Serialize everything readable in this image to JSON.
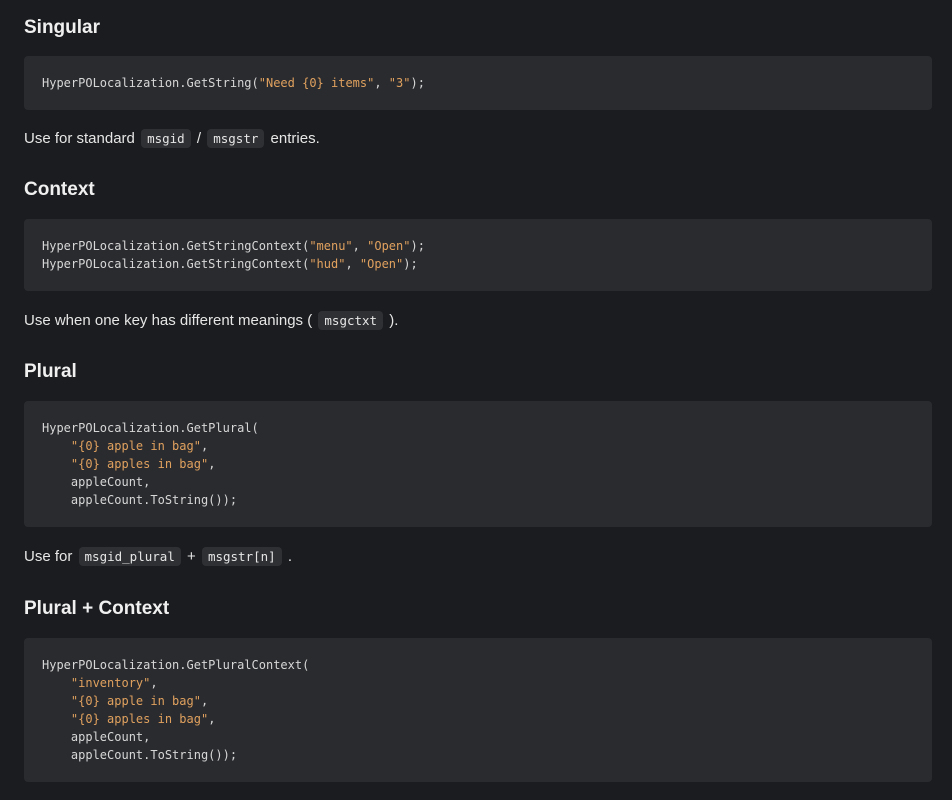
{
  "sections": [
    {
      "heading": "Singular",
      "code_lines": [
        [
          {
            "t": "HyperPOLocalization.GetString(",
            "s": false
          },
          {
            "t": "\"Need {0} items\"",
            "s": true
          },
          {
            "t": ", ",
            "s": false
          },
          {
            "t": "\"3\"",
            "s": true
          },
          {
            "t": ");",
            "s": false
          }
        ]
      ],
      "desc": {
        "before": "Use for standard",
        "code1": "msgid",
        "sep": "/",
        "code2": "msgstr",
        "after": "entries."
      }
    },
    {
      "heading": "Context",
      "code_lines": [
        [
          {
            "t": "HyperPOLocalization.GetStringContext(",
            "s": false
          },
          {
            "t": "\"menu\"",
            "s": true
          },
          {
            "t": ", ",
            "s": false
          },
          {
            "t": "\"Open\"",
            "s": true
          },
          {
            "t": ");",
            "s": false
          }
        ],
        [
          {
            "t": "HyperPOLocalization.GetStringContext(",
            "s": false
          },
          {
            "t": "\"hud\"",
            "s": true
          },
          {
            "t": ", ",
            "s": false
          },
          {
            "t": "\"Open\"",
            "s": true
          },
          {
            "t": ");",
            "s": false
          }
        ]
      ],
      "desc": {
        "before": "Use when one key has different meanings (",
        "code1": "msgctxt",
        "after": ")."
      }
    },
    {
      "heading": "Plural",
      "code_lines": [
        [
          {
            "t": "HyperPOLocalization.GetPlural(",
            "s": false
          }
        ],
        [
          {
            "t": "    ",
            "s": false
          },
          {
            "t": "\"{0} apple in bag\"",
            "s": true
          },
          {
            "t": ",",
            "s": false
          }
        ],
        [
          {
            "t": "    ",
            "s": false
          },
          {
            "t": "\"{0} apples in bag\"",
            "s": true
          },
          {
            "t": ",",
            "s": false
          }
        ],
        [
          {
            "t": "    appleCount,",
            "s": false
          }
        ],
        [
          {
            "t": "    appleCount.ToString());",
            "s": false
          }
        ]
      ],
      "desc": {
        "before": "Use for",
        "code1": "msgid_plural",
        "sep": "+",
        "code2": "msgstr[n]",
        "after": "."
      }
    },
    {
      "heading": "Plural + Context",
      "code_lines": [
        [
          {
            "t": "HyperPOLocalization.GetPluralContext(",
            "s": false
          }
        ],
        [
          {
            "t": "    ",
            "s": false
          },
          {
            "t": "\"inventory\"",
            "s": true
          },
          {
            "t": ",",
            "s": false
          }
        ],
        [
          {
            "t": "    ",
            "s": false
          },
          {
            "t": "\"{0} apple in bag\"",
            "s": true
          },
          {
            "t": ",",
            "s": false
          }
        ],
        [
          {
            "t": "    ",
            "s": false
          },
          {
            "t": "\"{0} apples in bag\"",
            "s": true
          },
          {
            "t": ",",
            "s": false
          }
        ],
        [
          {
            "t": "    appleCount,",
            "s": false
          }
        ],
        [
          {
            "t": "    appleCount.ToString());",
            "s": false
          }
        ]
      ]
    }
  ],
  "colors": {
    "background": "#1b1c1f",
    "code_block": "#2a2b2f",
    "string": "#e0a15e",
    "text": "#e6e6e6"
  }
}
